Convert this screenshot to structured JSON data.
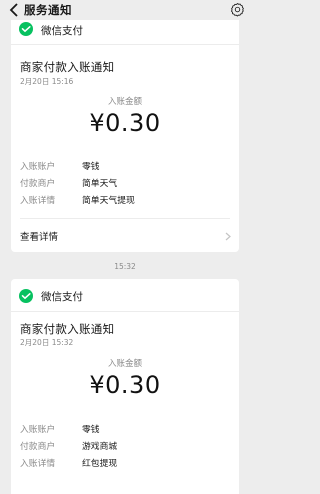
{
  "header": {
    "title": "服务通知",
    "back_icon": "back-arrow-icon",
    "settings_icon": "gear-icon"
  },
  "colors": {
    "background": "#ededed",
    "card": "#ffffff",
    "wechat_pay_green": "#07c160"
  },
  "messages": [
    {
      "brand": "微信支付",
      "title": "商家付款入账通知",
      "time": "2月20日  15:16",
      "amount_label": "入账金额",
      "amount": "¥0.30",
      "details": [
        {
          "key": "入账账户",
          "value": "零钱"
        },
        {
          "key": "付款商户",
          "value": "简单天气"
        },
        {
          "key": "入账详情",
          "value": "简单天气提现"
        }
      ],
      "link": "查看详情"
    },
    {
      "separator_time": "15:32",
      "brand": "微信支付",
      "title": "商家付款入账通知",
      "time": "2月20日  15:32",
      "amount_label": "入账金额",
      "amount": "¥0.30",
      "details": [
        {
          "key": "入账账户",
          "value": "零钱"
        },
        {
          "key": "付款商户",
          "value": "游戏商城"
        },
        {
          "key": "入账详情",
          "value": "红包提现"
        }
      ]
    }
  ]
}
